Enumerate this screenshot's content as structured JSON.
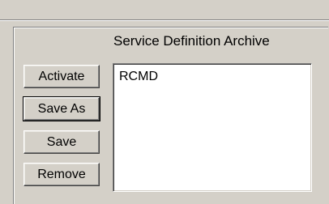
{
  "archive": {
    "title": "Service Definition Archive",
    "buttons": {
      "activate": "Activate",
      "save_as": "Save As",
      "save": "Save",
      "remove": "Remove"
    },
    "items": [
      "RCMD"
    ]
  }
}
